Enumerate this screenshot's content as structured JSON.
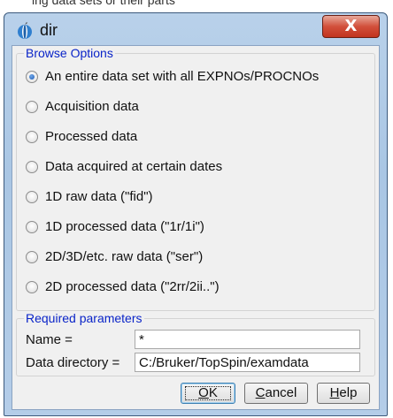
{
  "top_strip_text": "ing data sets or their parts",
  "window": {
    "title": "dir",
    "close_glyph": "X"
  },
  "browse_options": {
    "title": "Browse Options",
    "selected_index": 0,
    "items": [
      {
        "label": "An entire data set with all EXPNOs/PROCNOs"
      },
      {
        "label": "Acquisition data"
      },
      {
        "label": "Processed data"
      },
      {
        "label": "Data acquired at certain dates"
      },
      {
        "label": "1D raw data (\"fid\")"
      },
      {
        "label": "1D processed data (\"1r/1i\")"
      },
      {
        "label": "2D/3D/etc. raw data (\"ser\")"
      },
      {
        "label": "2D processed data (\"2rr/2ii..\")"
      }
    ]
  },
  "required_parameters": {
    "title": "Required parameters",
    "name_label": "Name =",
    "name_value": "*",
    "dir_label": "Data directory =",
    "dir_value": "C:/Bruker/TopSpin/examdata"
  },
  "buttons": {
    "ok": {
      "mnemonic": "O",
      "rest": "K"
    },
    "cancel": {
      "mnemonic": "C",
      "rest": "ancel"
    },
    "help": {
      "mnemonic": "H",
      "rest": "elp"
    }
  },
  "colors": {
    "group_title": "#0a24c8",
    "close_button": "#c2341f",
    "window_frame": "#b9d1ea"
  },
  "icons": {
    "app": "topspin-logo-icon",
    "close": "close-icon"
  }
}
